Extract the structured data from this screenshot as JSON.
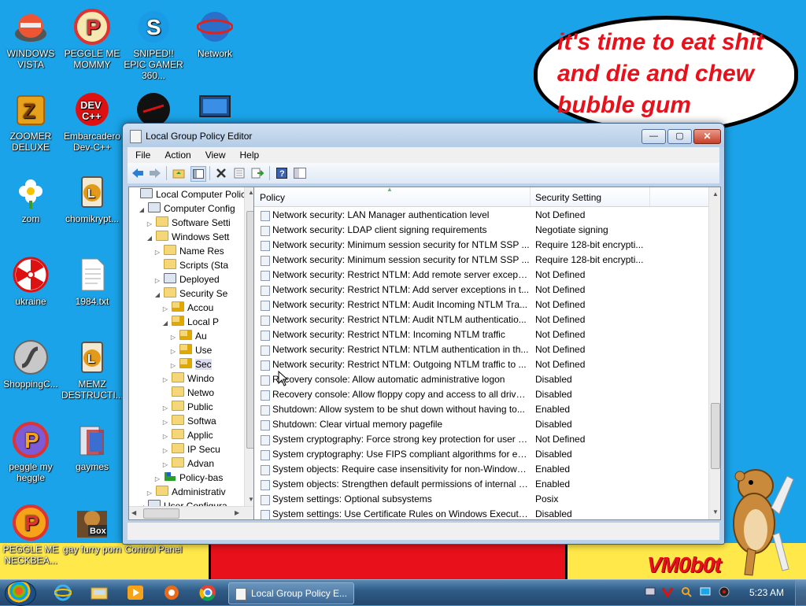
{
  "speech_bubble": {
    "text": "it's time to eat shit and die and chew bubble gum"
  },
  "watermark": "VM0b0t",
  "desktop_icons": [
    {
      "label": "WINDOWS VISTA",
      "icon": "vista-icon"
    },
    {
      "label": "PEGGLE ME MOMMY",
      "icon": "peggle-icon"
    },
    {
      "label": "SNIPED!! EPIC GAMER 360...",
      "icon": "skype-icon"
    },
    {
      "label": "Network",
      "icon": "network-icon"
    },
    {
      "label": "ZOOMER DELUXE",
      "icon": "zoomer-icon"
    },
    {
      "label": "Embarcadero Dev-C++",
      "icon": "devcpp-icon"
    },
    {
      "label": "zom",
      "icon": "flower-icon"
    },
    {
      "label": "chomikrypt...",
      "icon": "hourglass-icon"
    },
    {
      "label": "ukraine",
      "icon": "radiation-icon"
    },
    {
      "label": "1984.txt",
      "icon": "textfile-icon"
    },
    {
      "label": "ShoppingC...",
      "icon": "flash-icon"
    },
    {
      "label": "MEMZ DESTRUCTI...",
      "icon": "hourglass-icon"
    },
    {
      "label": "peggle my heggle",
      "icon": "peggle-icon"
    },
    {
      "label": "gaymes",
      "icon": "games-folder-icon"
    },
    {
      "label": "PEGGLE ME NECKBEA...",
      "icon": "peggle-icon"
    },
    {
      "label": "gay furry porn",
      "icon": "winrar-icon"
    },
    {
      "label": "Control Panel",
      "icon": "control-panel-icon"
    }
  ],
  "window": {
    "title": "Local Group Policy Editor",
    "min_glyph": "—",
    "max_glyph": "▢",
    "close_glyph": "✕",
    "menu": [
      "File",
      "Action",
      "View",
      "Help"
    ]
  },
  "tree": [
    {
      "label": "Local Computer Polic",
      "arrow": "",
      "icon": "computer-icon"
    },
    {
      "label": "Computer Config",
      "arrow": "◢",
      "icon": "computer-icon"
    },
    {
      "label": "Software Setti",
      "arrow": "▷",
      "icon": "folder-icon"
    },
    {
      "label": "Windows Sett",
      "arrow": "◢",
      "icon": "folder-icon"
    },
    {
      "label": "Name Res",
      "arrow": "▷",
      "icon": "folder-icon"
    },
    {
      "label": "Scripts (Sta",
      "arrow": "",
      "icon": "scripts-icon"
    },
    {
      "label": "Deployed",
      "arrow": "▷",
      "icon": "printer-icon"
    },
    {
      "label": "Security Se",
      "arrow": "◢",
      "icon": "security-icon"
    },
    {
      "label": "Accou",
      "arrow": "▷",
      "icon": "folder-lock-icon"
    },
    {
      "label": "Local P",
      "arrow": "◢",
      "icon": "folder-lock-icon"
    },
    {
      "label": "Au",
      "arrow": "▷",
      "icon": "folder-lock-icon"
    },
    {
      "label": "Use",
      "arrow": "▷",
      "icon": "folder-lock-icon"
    },
    {
      "label": "Sec",
      "arrow": "▷",
      "icon": "folder-lock-icon"
    },
    {
      "label": "Windo",
      "arrow": "▷",
      "icon": "folder-icon"
    },
    {
      "label": "Netwo",
      "arrow": "",
      "icon": "folder-icon"
    },
    {
      "label": "Public",
      "arrow": "▷",
      "icon": "folder-icon"
    },
    {
      "label": "Softwa",
      "arrow": "▷",
      "icon": "folder-icon"
    },
    {
      "label": "Applic",
      "arrow": "▷",
      "icon": "folder-icon"
    },
    {
      "label": "IP Secu",
      "arrow": "▷",
      "icon": "ipsec-icon"
    },
    {
      "label": "Advan",
      "arrow": "▷",
      "icon": "folder-icon"
    },
    {
      "label": "Policy-bas",
      "arrow": "▷",
      "icon": "chart-icon"
    },
    {
      "label": "Administrativ",
      "arrow": "▷",
      "icon": "folder-icon"
    },
    {
      "label": "User Configura",
      "arrow": "◢",
      "icon": "user-icon"
    }
  ],
  "list": {
    "col_policy": "Policy",
    "col_setting": "Security Setting",
    "rows": [
      {
        "policy": "Network security: LAN Manager authentication level",
        "setting": "Not Defined"
      },
      {
        "policy": "Network security: LDAP client signing requirements",
        "setting": "Negotiate signing"
      },
      {
        "policy": "Network security: Minimum session security for NTLM SSP ...",
        "setting": "Require 128-bit encrypti..."
      },
      {
        "policy": "Network security: Minimum session security for NTLM SSP ...",
        "setting": "Require 128-bit encrypti..."
      },
      {
        "policy": "Network security: Restrict NTLM: Add remote server excepti...",
        "setting": "Not Defined"
      },
      {
        "policy": "Network security: Restrict NTLM: Add server exceptions in t...",
        "setting": "Not Defined"
      },
      {
        "policy": "Network security: Restrict NTLM: Audit Incoming NTLM Tra...",
        "setting": "Not Defined"
      },
      {
        "policy": "Network security: Restrict NTLM: Audit NTLM authenticatio...",
        "setting": "Not Defined"
      },
      {
        "policy": "Network security: Restrict NTLM: Incoming NTLM traffic",
        "setting": "Not Defined"
      },
      {
        "policy": "Network security: Restrict NTLM: NTLM authentication in th...",
        "setting": "Not Defined"
      },
      {
        "policy": "Network security: Restrict NTLM: Outgoing NTLM traffic to ...",
        "setting": "Not Defined"
      },
      {
        "policy": "Recovery console: Allow automatic administrative logon",
        "setting": "Disabled"
      },
      {
        "policy": "Recovery console: Allow floppy copy and access to all drives...",
        "setting": "Disabled"
      },
      {
        "policy": "Shutdown: Allow system to be shut down without having to...",
        "setting": "Enabled"
      },
      {
        "policy": "Shutdown: Clear virtual memory pagefile",
        "setting": "Disabled"
      },
      {
        "policy": "System cryptography: Force strong key protection for user k...",
        "setting": "Not Defined"
      },
      {
        "policy": "System cryptography: Use FIPS compliant algorithms for en...",
        "setting": "Disabled"
      },
      {
        "policy": "System objects: Require case insensitivity for non-Windows ...",
        "setting": "Enabled"
      },
      {
        "policy": "System objects: Strengthen default permissions of internal s...",
        "setting": "Enabled"
      },
      {
        "policy": "System settings: Optional subsystems",
        "setting": "Posix"
      },
      {
        "policy": "System settings: Use Certificate Rules on Windows Executabl...",
        "setting": "Disabled"
      }
    ]
  },
  "taskbar": {
    "active_task": "Local Group Policy E...",
    "pinned": [
      "internet-explorer-icon",
      "explorer-icon",
      "media-player-icon",
      "app-icon",
      "chrome-icon"
    ],
    "tray": [
      "network-tray-icon",
      "antivirus-tray-icon",
      "search-tray-icon",
      "display-tray-icon",
      "volume-tray-icon"
    ],
    "clock": "5:23 AM"
  },
  "colors": {
    "desktop": "#1aa3e8",
    "bubble_text": "#e8101a",
    "ground": "#ffe94a"
  }
}
